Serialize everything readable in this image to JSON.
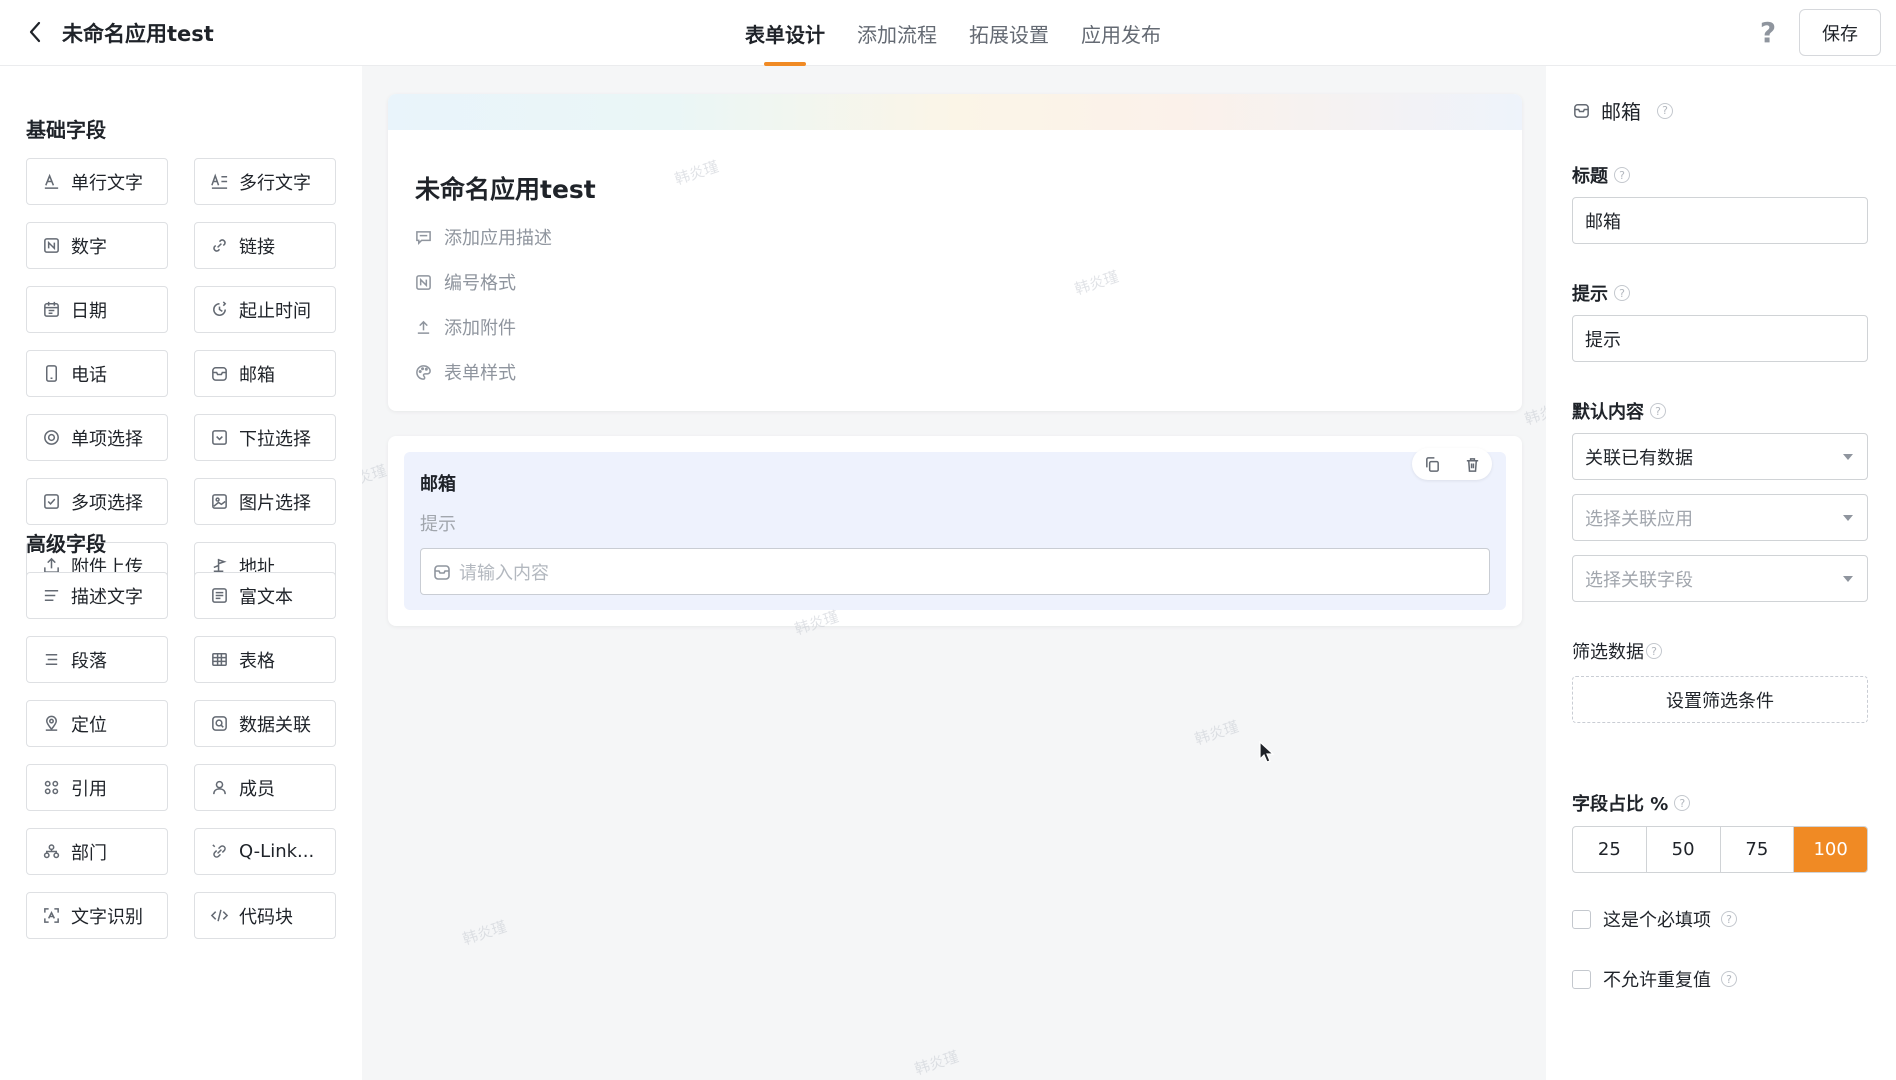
{
  "header": {
    "app_title": "未命名应用test",
    "tabs": [
      {
        "label": "表单设计",
        "active": true
      },
      {
        "label": "添加流程",
        "active": false
      },
      {
        "label": "拓展设置",
        "active": false
      },
      {
        "label": "应用发布",
        "active": false
      }
    ],
    "help_label": "?",
    "save_label": "保存"
  },
  "left_panel": {
    "basic_title": "基础字段",
    "basic_fields": [
      {
        "label": "单行文字",
        "icon": "text-line-icon"
      },
      {
        "label": "多行文字",
        "icon": "multiline-text-icon"
      },
      {
        "label": "数字",
        "icon": "number-icon"
      },
      {
        "label": "链接",
        "icon": "link-icon"
      },
      {
        "label": "日期",
        "icon": "calendar-icon"
      },
      {
        "label": "起止时间",
        "icon": "time-range-icon"
      },
      {
        "label": "电话",
        "icon": "phone-icon"
      },
      {
        "label": "邮箱",
        "icon": "mailbox-icon"
      },
      {
        "label": "单项选择",
        "icon": "radio-icon"
      },
      {
        "label": "下拉选择",
        "icon": "dropdown-icon"
      },
      {
        "label": "多项选择",
        "icon": "checkbox-icon"
      },
      {
        "label": "图片选择",
        "icon": "image-icon"
      },
      {
        "label": "附件上传",
        "icon": "upload-icon"
      },
      {
        "label": "地址",
        "icon": "location-pin-icon"
      }
    ],
    "advanced_title": "高级字段",
    "advanced_fields": [
      {
        "label": "描述文字",
        "icon": "description-icon"
      },
      {
        "label": "富文本",
        "icon": "rich-text-icon"
      },
      {
        "label": "段落",
        "icon": "paragraph-icon"
      },
      {
        "label": "表格",
        "icon": "table-icon"
      },
      {
        "label": "定位",
        "icon": "map-marker-icon"
      },
      {
        "label": "数据关联",
        "icon": "data-link-icon"
      },
      {
        "label": "引用",
        "icon": "reference-icon"
      },
      {
        "label": "成员",
        "icon": "user-icon"
      },
      {
        "label": "部门",
        "icon": "department-icon"
      },
      {
        "label": "Q-Link...",
        "icon": "qlink-icon"
      },
      {
        "label": "文字识别",
        "icon": "ocr-icon"
      },
      {
        "label": "代码块",
        "icon": "code-icon"
      }
    ]
  },
  "canvas": {
    "form_title": "未命名应用test",
    "form_options": [
      {
        "label": "添加应用描述",
        "icon": "comment-icon"
      },
      {
        "label": "编号格式",
        "icon": "number-format-icon"
      },
      {
        "label": "添加附件",
        "icon": "attachment-upload-icon"
      },
      {
        "label": "表单样式",
        "icon": "palette-icon"
      }
    ],
    "field": {
      "label": "邮箱",
      "hint": "提示",
      "placeholder": "请输入内容"
    },
    "watermark": "韩炎瑾"
  },
  "right_panel": {
    "heading": "邮箱",
    "title_label": "标题",
    "title_value": "邮箱",
    "hint_label": "提示",
    "hint_value": "提示",
    "default_label": "默认内容",
    "default_mode": "关联已有数据",
    "related_app_placeholder": "选择关联应用",
    "related_field_placeholder": "选择关联字段",
    "filter_label": "筛选数据",
    "filter_button": "设置筛选条件",
    "ratio_label": "字段占比 %",
    "ratio_options": [
      "25",
      "50",
      "75",
      "100"
    ],
    "ratio_selected": "100",
    "required_label": "这是个必填项",
    "required_checked": false,
    "no_duplicate_label": "不允许重复值",
    "no_duplicate_checked": false
  },
  "colors": {
    "accent": "#f08a24",
    "selected_field_bg": "#eef2fd"
  }
}
